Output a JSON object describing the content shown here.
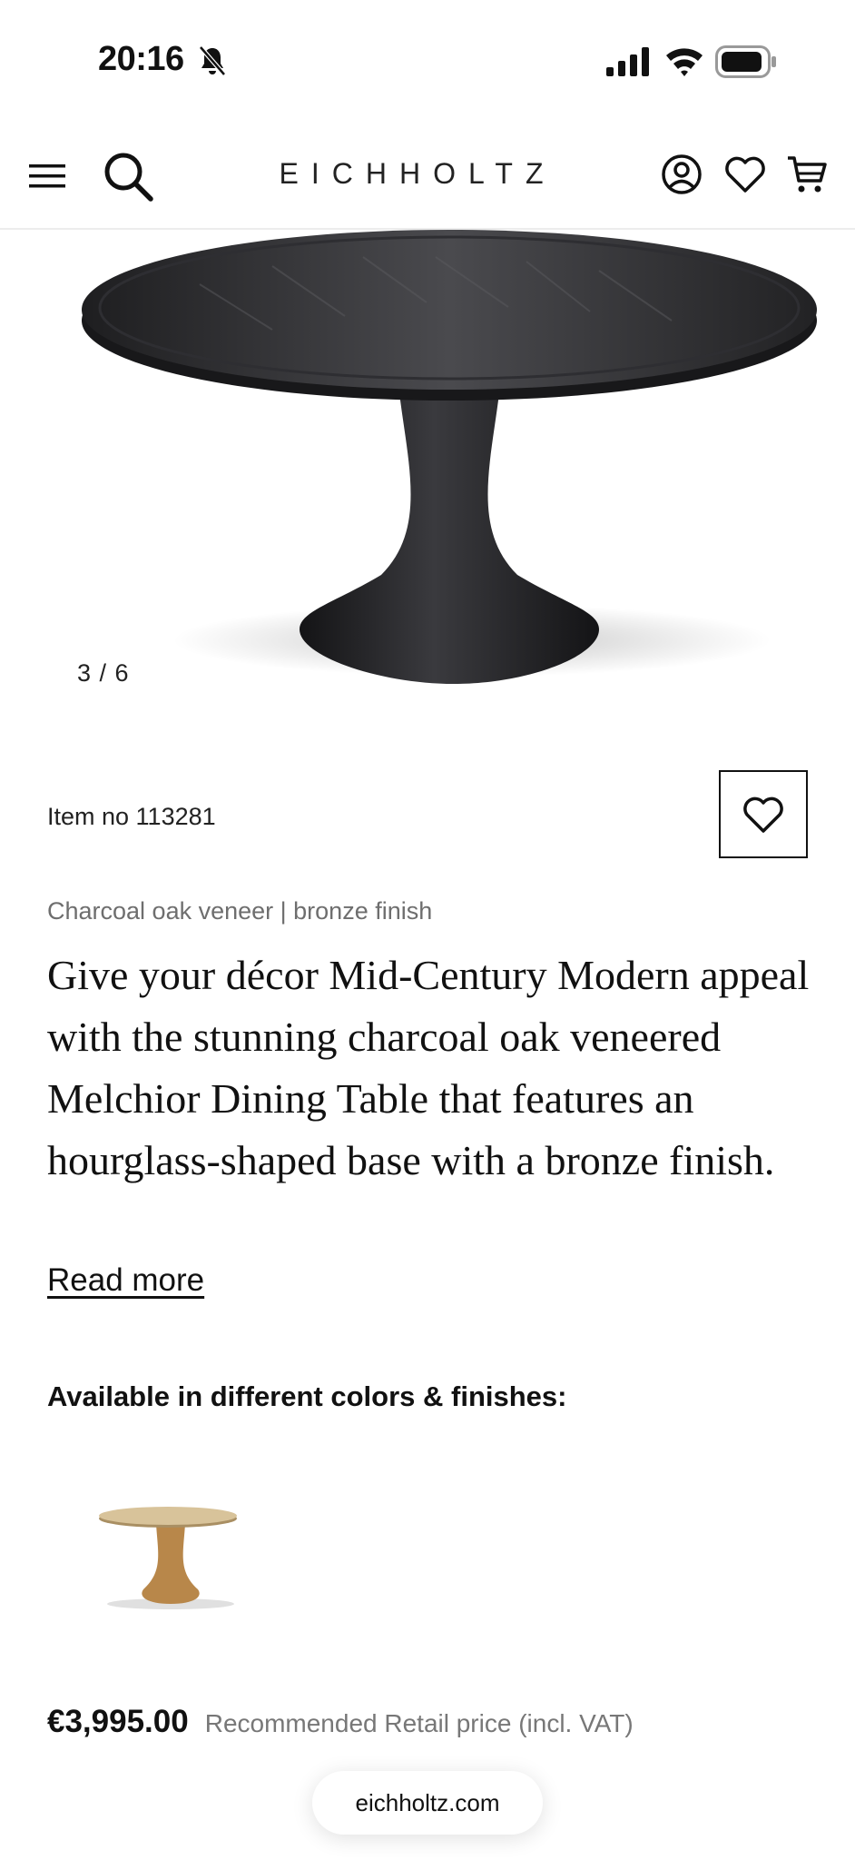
{
  "status_bar": {
    "time": "20:16"
  },
  "header": {
    "brand": "EICHHOLTZ"
  },
  "gallery": {
    "counter": "3 / 6"
  },
  "product": {
    "item_no": "Item no 113281",
    "material": "Charcoal oak veneer | bronze finish",
    "description": "Give your décor Mid-Century Modern appeal with the stunning charcoal oak veneered Melchior Dining Table that features an hourglass-shaped base with a bronze finish.",
    "read_more": "Read more",
    "colors_heading": "Available in different colors & finishes:",
    "price": "€3,995.00",
    "price_note": "Recommended Retail price (incl. VAT)"
  },
  "browser": {
    "url": "eichholtz.com"
  },
  "colors": {
    "table_top_dark": "#2a2a2c",
    "table_base_dark": "#1e1e20",
    "variant_brass": "#c9a46a"
  }
}
